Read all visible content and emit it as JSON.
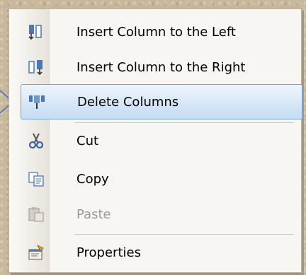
{
  "menu": {
    "items": [
      {
        "label": "Insert Column to the Left",
        "icon": "insert-column-left-icon",
        "enabled": true,
        "selected": false
      },
      {
        "label": "Insert Column to the Right",
        "icon": "insert-column-right-icon",
        "enabled": true,
        "selected": false
      },
      {
        "label": "Delete Columns",
        "icon": "delete-columns-icon",
        "enabled": true,
        "selected": true
      },
      {
        "label": "Cut",
        "icon": "scissors-icon",
        "enabled": true,
        "selected": false
      },
      {
        "label": "Copy",
        "icon": "copy-icon",
        "enabled": true,
        "selected": false
      },
      {
        "label": "Paste",
        "icon": "paste-icon",
        "enabled": false,
        "selected": false
      },
      {
        "label": "Properties",
        "icon": "properties-icon",
        "enabled": true,
        "selected": false
      }
    ]
  },
  "colors": {
    "selection_border": "#7da2ce",
    "selection_fill": "#c4dcf4",
    "disabled_text": "#9a9a9a",
    "background_texture": "#c9b79a"
  }
}
